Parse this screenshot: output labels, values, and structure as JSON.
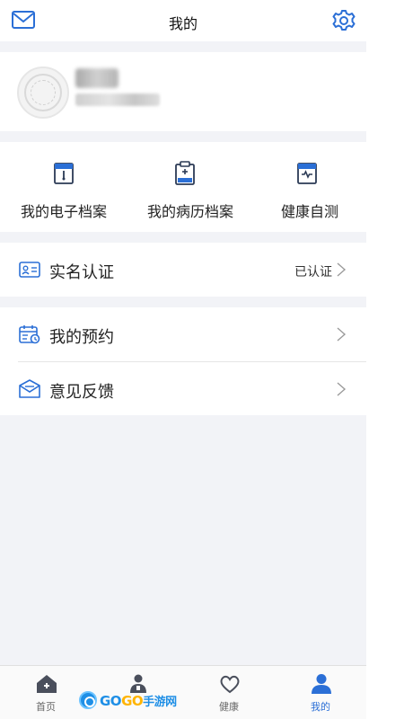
{
  "header": {
    "title": "我的",
    "mail_icon": "mail-icon",
    "settings_icon": "gear-icon"
  },
  "profile": {
    "avatar_icon": "avatar-seal"
  },
  "records": [
    {
      "label": "我的电子档案",
      "icon": "e-record-icon"
    },
    {
      "label": "我的病历档案",
      "icon": "medical-record-icon"
    },
    {
      "label": "健康自测",
      "icon": "health-test-icon"
    }
  ],
  "real_name": {
    "label": "实名认证",
    "status": "已认证",
    "icon": "id-card-icon"
  },
  "list": [
    {
      "label": "我的预约",
      "icon": "calendar-icon"
    },
    {
      "label": "意见反馈",
      "icon": "feedback-icon"
    }
  ],
  "tabs": [
    {
      "label": "首页",
      "icon": "home-icon",
      "active": false
    },
    {
      "label": "",
      "icon": "doctor-icon",
      "active": false
    },
    {
      "label": "健康",
      "icon": "heart-icon",
      "active": false
    },
    {
      "label": "我的",
      "icon": "user-icon",
      "active": true
    }
  ],
  "watermark": {
    "brand_a": "GO",
    "brand_b": "GO",
    "brand_c": "手游网"
  },
  "colors": {
    "accent": "#2b6fd6",
    "background": "#f2f3f7",
    "card": "#ffffff"
  }
}
